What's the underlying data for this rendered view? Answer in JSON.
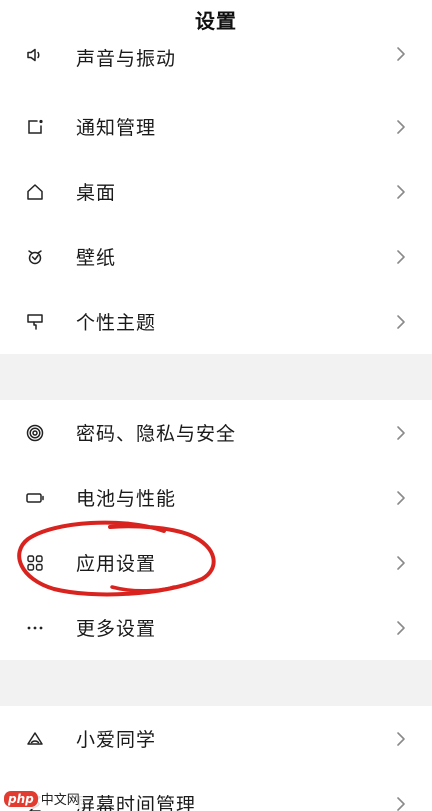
{
  "header": {
    "title": "设置"
  },
  "groups": [
    {
      "items": [
        {
          "label": "声音与振动",
          "icon": "speaker-icon"
        },
        {
          "label": "通知管理",
          "icon": "notification-icon"
        },
        {
          "label": "桌面",
          "icon": "home-icon"
        },
        {
          "label": "壁纸",
          "icon": "wallpaper-icon"
        },
        {
          "label": "个性主题",
          "icon": "theme-brush-icon"
        }
      ]
    },
    {
      "items": [
        {
          "label": "密码、隐私与安全",
          "icon": "fingerprint-icon"
        },
        {
          "label": "电池与性能",
          "icon": "battery-icon"
        },
        {
          "label": "应用设置",
          "icon": "apps-grid-icon"
        },
        {
          "label": "更多设置",
          "icon": "more-dots-icon"
        }
      ]
    },
    {
      "items": [
        {
          "label": "小爱同学",
          "icon": "assistant-icon"
        },
        {
          "label": "屏幕时间管理",
          "icon": "hourglass-icon"
        }
      ]
    }
  ],
  "annotation": {
    "color": "#d9231f"
  },
  "watermark": {
    "badge": "php",
    "text": "中文网"
  }
}
